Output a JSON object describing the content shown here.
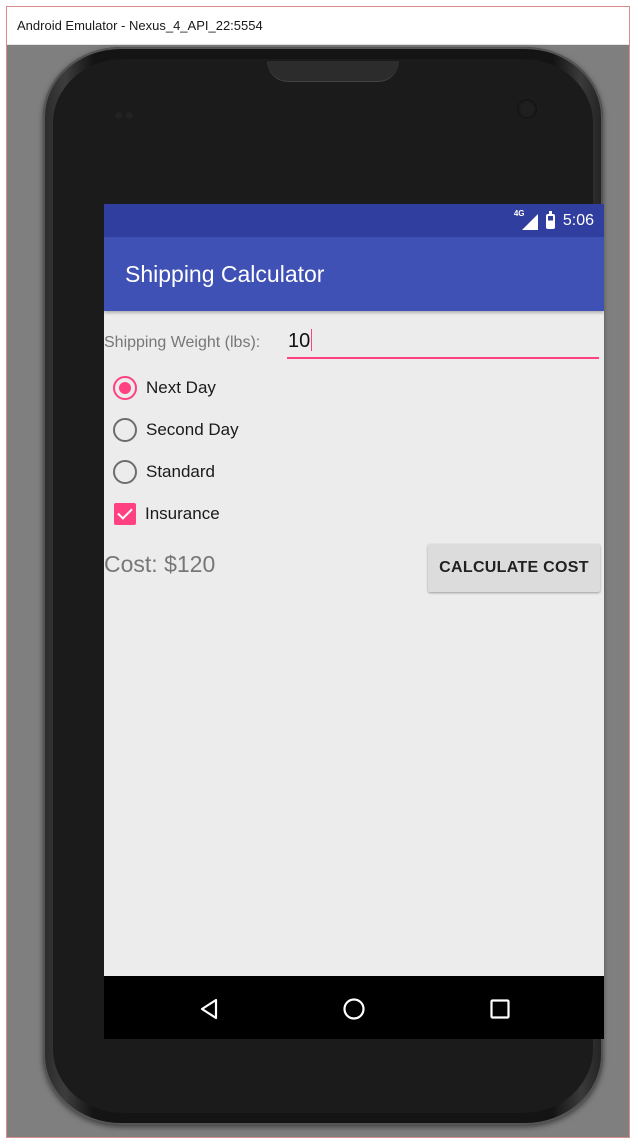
{
  "window": {
    "title": "Android Emulator - Nexus_4_API_22:5554"
  },
  "statusbar": {
    "network_label": "4G",
    "time": "5:06",
    "network_icon": "signal-icon",
    "battery_icon": "battery-icon"
  },
  "appbar": {
    "title": "Shipping Calculator",
    "color": "#3f51b5",
    "status_color": "#303f9f"
  },
  "form": {
    "weight_label": "Shipping Weight (lbs):",
    "weight_value": "10",
    "shipping_options": [
      {
        "label": "Next Day",
        "selected": true
      },
      {
        "label": "Second Day",
        "selected": false
      },
      {
        "label": "Standard",
        "selected": false
      }
    ],
    "insurance_label": "Insurance",
    "insurance_checked": true,
    "accent_color": "#ff4081"
  },
  "result": {
    "cost_text": "Cost: $120"
  },
  "actions": {
    "calculate_label": "CALCULATE COST"
  },
  "navbar": {
    "back_icon": "back-icon",
    "home_icon": "home-icon",
    "recents_icon": "recents-icon"
  }
}
